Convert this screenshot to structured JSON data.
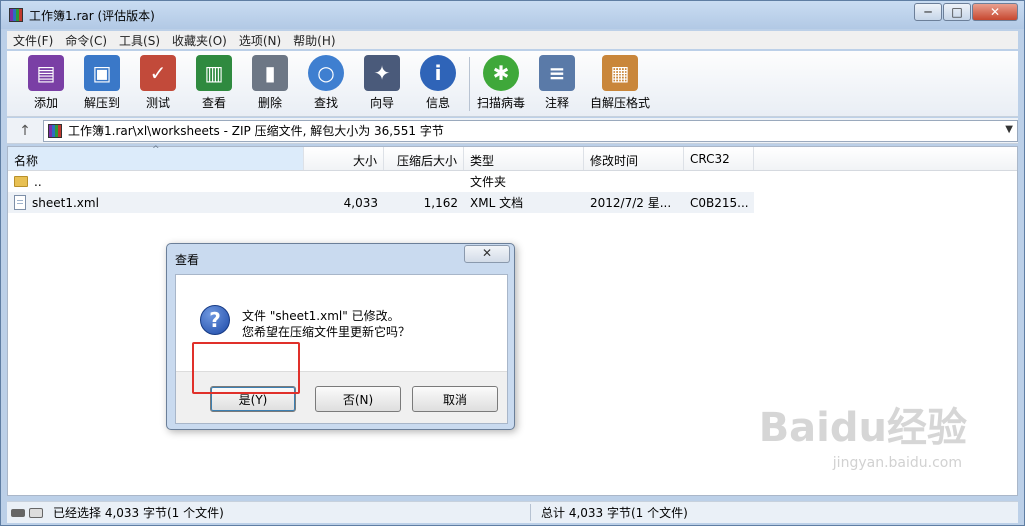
{
  "window": {
    "title": "工作簿1.rar (评估版本)"
  },
  "winbuttons": {
    "minimize": "─",
    "maximize": "□",
    "close": "✕"
  },
  "menu": [
    "文件(F)",
    "命令(C)",
    "工具(S)",
    "收藏夹(O)",
    "选项(N)",
    "帮助(H)"
  ],
  "toolbar": [
    {
      "label": "添加",
      "icon": "add-archive-icon",
      "color": "#7a3fa5"
    },
    {
      "label": "解压到",
      "icon": "extract-folder-icon",
      "color": "#3a78c8"
    },
    {
      "label": "测试",
      "icon": "test-checklist-icon",
      "color": "#c24a3a"
    },
    {
      "label": "查看",
      "icon": "view-book-icon",
      "color": "#2f8a3f"
    },
    {
      "label": "删除",
      "icon": "trash-icon",
      "color": "#6d7785"
    },
    {
      "label": "查找",
      "icon": "magnifier-icon",
      "color": "#3f7fd0"
    },
    {
      "label": "向导",
      "icon": "wizard-wand-icon",
      "color": "#4a5a7a"
    },
    {
      "label": "信息",
      "icon": "info-icon",
      "color": "#2f64b8"
    },
    {
      "label": "扫描病毒",
      "icon": "virus-scan-icon",
      "color": "#3fa83a"
    },
    {
      "label": "注释",
      "icon": "comment-icon",
      "color": "#5a7aa8"
    },
    {
      "label": "自解压格式",
      "icon": "sfx-box-icon",
      "color": "#c9863a"
    }
  ],
  "address": {
    "up": "↑",
    "path": "工作簿1.rar\\xl\\worksheets - ZIP 压缩文件, 解包大小为 36,551 字节",
    "dropdown": "▼"
  },
  "columns": {
    "name": "名称",
    "size": "大小",
    "packed": "压缩后大小",
    "type": "类型",
    "modified": "修改时间",
    "crc": "CRC32"
  },
  "rows": [
    {
      "name": "..",
      "size": "",
      "packed": "",
      "type": "文件夹",
      "modified": "",
      "crc": ""
    },
    {
      "name": "sheet1.xml",
      "size": "4,033",
      "packed": "1,162",
      "type": "XML 文档",
      "modified": "2012/7/2 星...",
      "crc": "C0B215..."
    }
  ],
  "status": {
    "left": "已经选择 4,033 字节(1 个文件)",
    "right": "总计 4,033 字节(1 个文件)"
  },
  "dialog": {
    "title": "查看",
    "close": "✕",
    "message_line1": "文件 \"sheet1.xml\" 已修改。",
    "message_line2": "您希望在压缩文件里更新它吗？",
    "yes": "是(Y)",
    "no": "否(N)",
    "cancel": "取消"
  },
  "watermark": {
    "main": "Baidu经验",
    "sub": "jingyan.baidu.com"
  }
}
